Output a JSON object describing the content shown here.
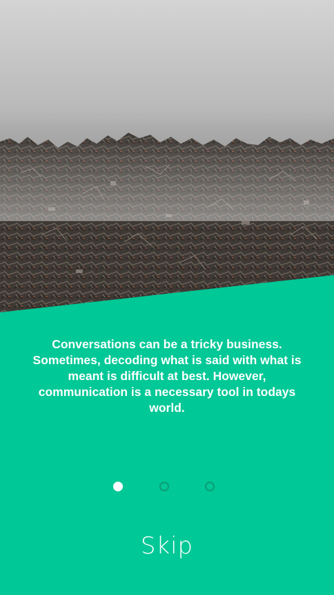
{
  "hero": {
    "image_subject": "landfill-trash-pile"
  },
  "onboarding": {
    "message": "Conversations can be a tricky business. Sometimes, decoding what is said with what is meant is difficult at best. However, communication is a necessary tool in todays world.",
    "page_count": 3,
    "active_page": 1
  },
  "actions": {
    "skip_label": "Skip"
  },
  "colors": {
    "accent": "#00c896",
    "dot_inactive_border": "#0c9d76",
    "text": "#ffffff"
  }
}
